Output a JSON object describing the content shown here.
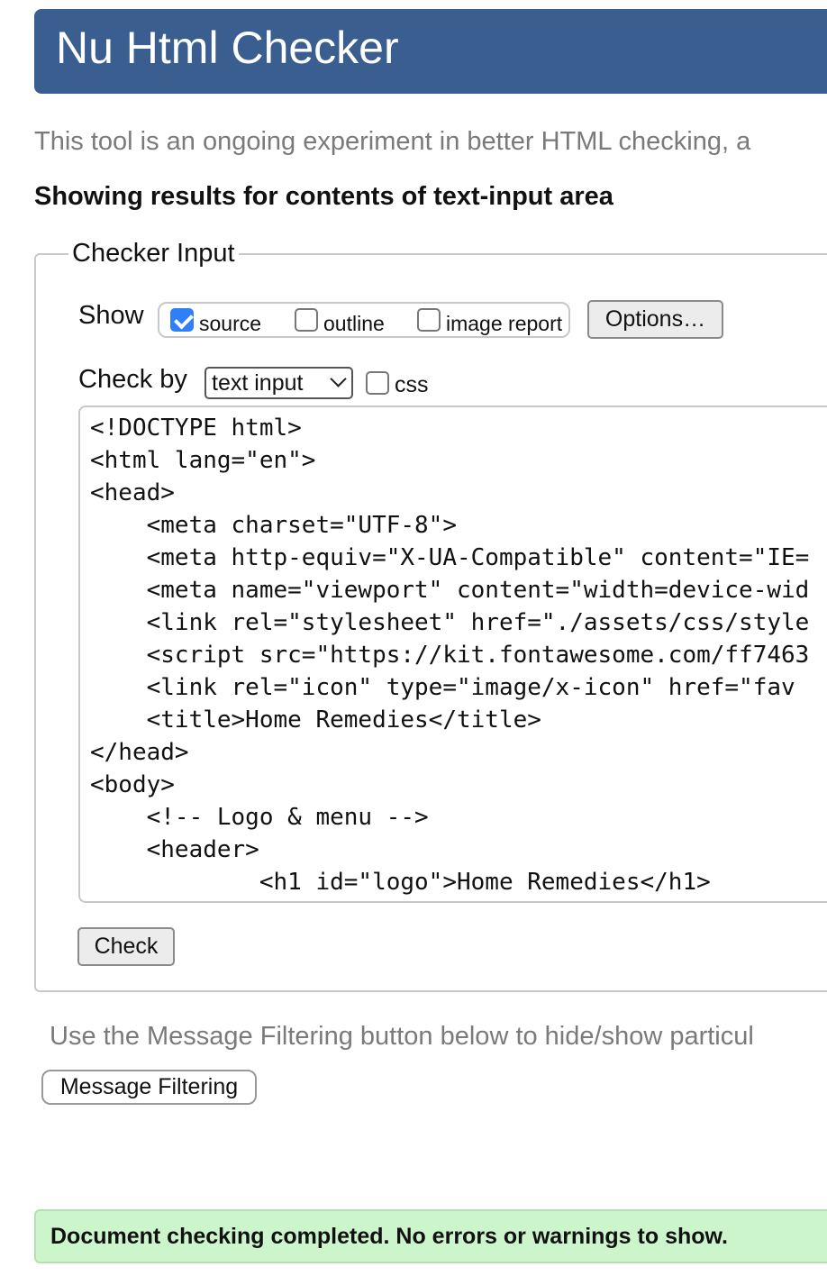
{
  "header": {
    "title": "Nu Html Checker"
  },
  "intro_text": "This tool is an ongoing experiment in better HTML checking, a",
  "results_heading": "Showing results for contents of text-input area",
  "checker_input": {
    "legend": "Checker Input",
    "show_label": "Show",
    "show_options": [
      {
        "label": "source",
        "checked": true
      },
      {
        "label": "outline",
        "checked": false
      },
      {
        "label": "image report",
        "checked": false
      }
    ],
    "options_button": "Options…",
    "check_by_label": "Check by",
    "check_by_value": "text input",
    "css_label": "css",
    "css_checked": false,
    "code_lines": [
      "<!DOCTYPE html>",
      "<html lang=\"en\">",
      "<head>",
      "    <meta charset=\"UTF-8\">",
      "    <meta http-equiv=\"X-UA-Compatible\" content=\"IE=",
      "    <meta name=\"viewport\" content=\"width=device-wid",
      "    <link rel=\"stylesheet\" href=\"./assets/css/style",
      "    <script src=\"https://kit.fontawesome.com/ff7463",
      "    <link rel=\"icon\" type=\"image/x-icon\" href=\"fav",
      "    <title>Home Remedies</title>",
      "</head>",
      "<body>",
      "    <!-- Logo & menu -->",
      "    <header>",
      "            <h1 id=\"logo\">Home Remedies</h1>"
    ],
    "check_button": "Check"
  },
  "filter_note": "Use the Message Filtering button below to hide/show particul",
  "message_filtering_button": "Message Filtering",
  "status": {
    "message": "Document checking completed. No errors or warnings to show.",
    "color": "#ccf5cc"
  },
  "colors": {
    "banner": "#3b5e91",
    "checkbox_checked": "#2f7ff6"
  }
}
